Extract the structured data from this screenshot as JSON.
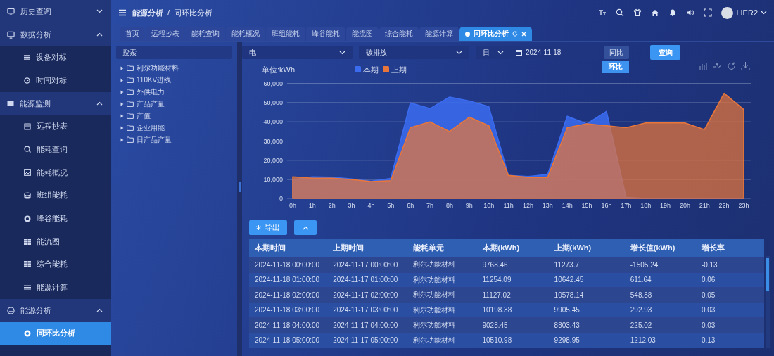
{
  "sidebar": {
    "items": [
      {
        "kind": "group",
        "label": "历史查询",
        "expanded": false
      },
      {
        "kind": "group",
        "label": "数据分析",
        "expanded": true
      },
      {
        "kind": "item",
        "label": "设备对标",
        "selected": false
      },
      {
        "kind": "item",
        "label": "时间对标",
        "selected": false
      },
      {
        "kind": "group",
        "label": "能源监测",
        "expanded": true
      },
      {
        "kind": "item",
        "label": "远程抄表",
        "selected": false
      },
      {
        "kind": "item",
        "label": "能耗查询",
        "selected": false
      },
      {
        "kind": "item",
        "label": "能耗概况",
        "selected": false
      },
      {
        "kind": "item",
        "label": "班组能耗",
        "selected": false
      },
      {
        "kind": "item",
        "label": "峰谷能耗",
        "selected": false
      },
      {
        "kind": "item",
        "label": "能流图",
        "selected": false
      },
      {
        "kind": "item",
        "label": "综合能耗",
        "selected": false
      },
      {
        "kind": "item",
        "label": "能源计算",
        "selected": false
      },
      {
        "kind": "group",
        "label": "能源分析",
        "expanded": true
      },
      {
        "kind": "item",
        "label": "同环比分析",
        "selected": true
      }
    ]
  },
  "header": {
    "breadcrumb": [
      "能源分析",
      "同环比分析"
    ],
    "separator": "/",
    "user": "LIER2"
  },
  "tabs": [
    {
      "label": "首页",
      "selected": false
    },
    {
      "label": "远程抄表",
      "selected": false
    },
    {
      "label": "能耗查询",
      "selected": false
    },
    {
      "label": "能耗概况",
      "selected": false
    },
    {
      "label": "班组能耗",
      "selected": false
    },
    {
      "label": "峰谷能耗",
      "selected": false
    },
    {
      "label": "能流图",
      "selected": false
    },
    {
      "label": "综合能耗",
      "selected": false
    },
    {
      "label": "能源计算",
      "selected": false
    },
    {
      "label": "同环比分析",
      "selected": true
    }
  ],
  "tree": {
    "search_placeholder": "搜索",
    "items": [
      {
        "label": "利尔功能材料",
        "expanded": false
      },
      {
        "label": "110KV进线",
        "expanded": false
      },
      {
        "label": "外供电力",
        "expanded": false
      },
      {
        "label": "产品产量",
        "expanded": false
      },
      {
        "label": "产值",
        "expanded": false
      },
      {
        "label": "企业用能",
        "expanded": false
      },
      {
        "label": "日产品产量",
        "expanded": false
      }
    ]
  },
  "filters": {
    "energy_type": "电",
    "metric": "碳排放",
    "period": "日",
    "date": "2024-11-18",
    "compare": {
      "value": "同比",
      "expanded": true,
      "options": [
        {
          "label": "环比",
          "selected": true
        }
      ]
    },
    "query_button": "查询"
  },
  "chart": {
    "chart_data": {
      "type": "area",
      "ylabel": "单位:kWh",
      "categories": [
        "0h",
        "1h",
        "2h",
        "3h",
        "4h",
        "5h",
        "6h",
        "7h",
        "8h",
        "9h",
        "10h",
        "11h",
        "12h",
        "13h",
        "14h",
        "15h",
        "16h",
        "17h",
        "18h",
        "19h",
        "20h",
        "21h",
        "22h",
        "23h"
      ],
      "series": [
        {
          "name": "本期",
          "color": "#3b6cf0",
          "values": [
            9800,
            11300,
            11100,
            10200,
            9000,
            10500,
            50000,
            47000,
            53000,
            51000,
            48000,
            12000,
            11500,
            12500,
            43000,
            39000,
            45500,
            500,
            0,
            0,
            0,
            0,
            0,
            0
          ]
        },
        {
          "name": "上期",
          "color": "#e8763a",
          "values": [
            11300,
            10600,
            10600,
            9900,
            8800,
            9300,
            37000,
            40000,
            35000,
            42500,
            38000,
            12000,
            11000,
            11000,
            37000,
            39000,
            38000,
            37000,
            39500,
            39500,
            39500,
            36000,
            55000,
            46500
          ]
        }
      ],
      "grid": true,
      "legend": "top",
      "ylim": [
        0,
        60000
      ],
      "yticks": [
        {
          "value": 0,
          "label": "0"
        },
        {
          "value": 10000,
          "label": "10,000"
        },
        {
          "value": 20000,
          "label": "20,000"
        },
        {
          "value": 30000,
          "label": "30,000"
        },
        {
          "value": 40000,
          "label": "40,000"
        },
        {
          "value": 50000,
          "label": "50,000"
        },
        {
          "value": 60000,
          "label": "60,000"
        }
      ]
    }
  },
  "table_toolbar": {
    "export_button": "导出"
  },
  "table": {
    "columns": [
      "本期时间",
      "上期时间",
      "能耗单元",
      "本期(kWh)",
      "上期(kWh)",
      "增长值(kWh)",
      "增长率"
    ],
    "rows": [
      [
        "2024-11-18 00:00:00",
        "2024-11-17 00:00:00",
        "利尔功能材料",
        "9768.46",
        "11273.7",
        "-1505.24",
        "-0.13"
      ],
      [
        "2024-11-18 01:00:00",
        "2024-11-17 01:00:00",
        "利尔功能材料",
        "11254.09",
        "10642.45",
        "611.64",
        "0.06"
      ],
      [
        "2024-11-18 02:00:00",
        "2024-11-17 02:00:00",
        "利尔功能材料",
        "11127.02",
        "10578.14",
        "548.88",
        "0.05"
      ],
      [
        "2024-11-18 03:00:00",
        "2024-11-17 03:00:00",
        "利尔功能材料",
        "10198.38",
        "9905.45",
        "292.93",
        "0.03"
      ],
      [
        "2024-11-18 04:00:00",
        "2024-11-17 04:00:00",
        "利尔功能材料",
        "9028.45",
        "8803.43",
        "225.02",
        "0.03"
      ],
      [
        "2024-11-18 05:00:00",
        "2024-11-17 05:00:00",
        "利尔功能材料",
        "10510.98",
        "9298.95",
        "1212.03",
        "0.13"
      ]
    ]
  }
}
